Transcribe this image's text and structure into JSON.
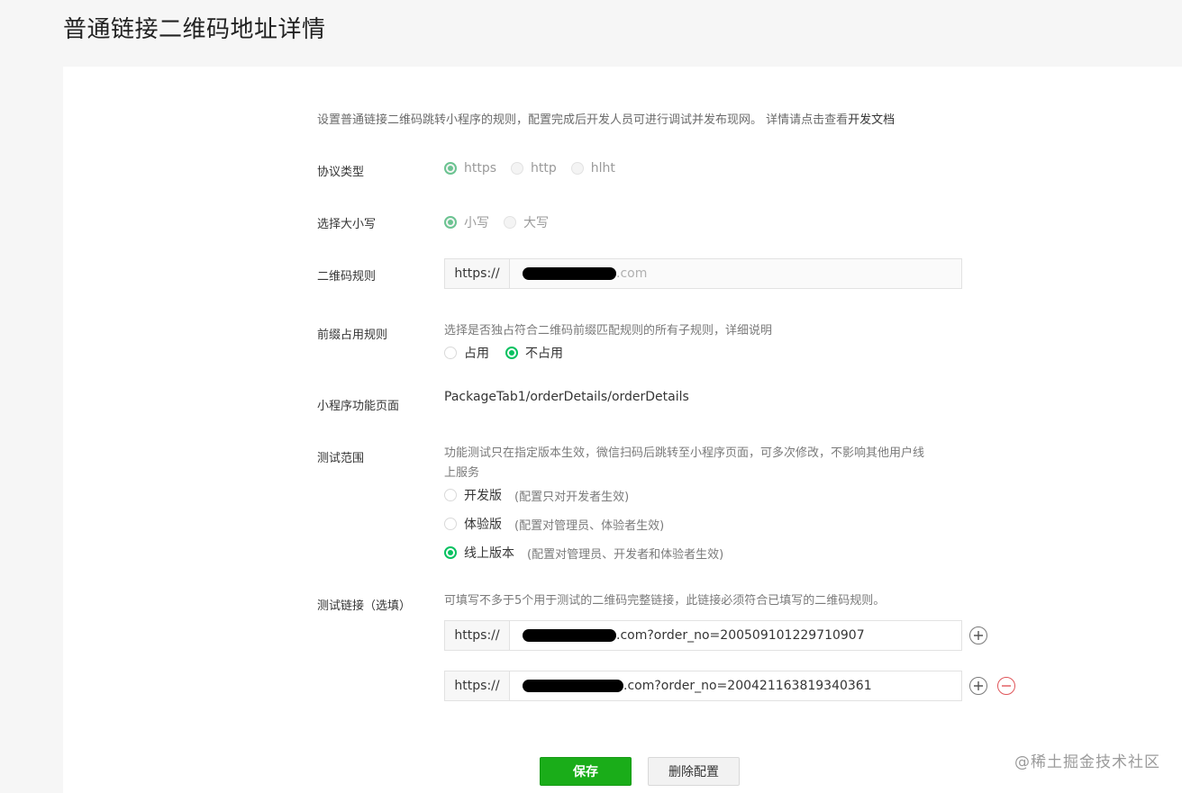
{
  "page": {
    "title": "普通链接二维码地址详情"
  },
  "intro": {
    "text": "设置普通链接二维码跳转小程序的规则，配置完成后开发人员可进行调试并发布现网。 详情请点击查看",
    "link": "开发文档"
  },
  "protocol": {
    "label": "协议类型",
    "options": [
      "https",
      "http",
      "hlht"
    ],
    "selected": "https"
  },
  "case": {
    "label": "选择大小写",
    "options": [
      "小写",
      "大写"
    ],
    "selected": "小写"
  },
  "qr_rule": {
    "label": "二维码规则",
    "prefix": "https://",
    "suffix": ".com"
  },
  "prefix_rule": {
    "label": "前缀占用规则",
    "hint": "选择是否独占符合二维码前缀匹配规则的所有子规则，详细说明",
    "options": [
      "占用",
      "不占用"
    ],
    "selected": "不占用"
  },
  "page_path": {
    "label": "小程序功能页面",
    "value": "PackageTab1/orderDetails/orderDetails"
  },
  "test_scope": {
    "label": "测试范围",
    "hint_line1": "功能测试只在指定版本生效，微信扫码后跳转至小程序页面，可多次修改，不影响其他用户线",
    "hint_line2": "上服务",
    "options": [
      {
        "name": "开发版",
        "note": "(配置只对开发者生效)"
      },
      {
        "name": "体验版",
        "note": "(配置对管理员、体验者生效)"
      },
      {
        "name": "线上版本",
        "note": "(配置对管理员、开发者和体验者生效)"
      }
    ],
    "selected": "线上版本"
  },
  "test_links": {
    "label": "测试链接（选填）",
    "hint": "可填写不多于5个用于测试的二维码完整链接，此链接必须符合已填写的二维码规则。",
    "items": [
      {
        "prefix": "https://",
        "suffix": ".com?order_no=200509101229710907"
      },
      {
        "prefix": "https://",
        "suffix": ".com?order_no=200421163819340361"
      }
    ]
  },
  "buttons": {
    "save": "保存",
    "delete": "删除配置"
  },
  "watermark": "@稀土掘金技术社区",
  "colors": {
    "accent": "#07c160",
    "primary_button": "#1aad19",
    "danger": "#e0565a"
  }
}
